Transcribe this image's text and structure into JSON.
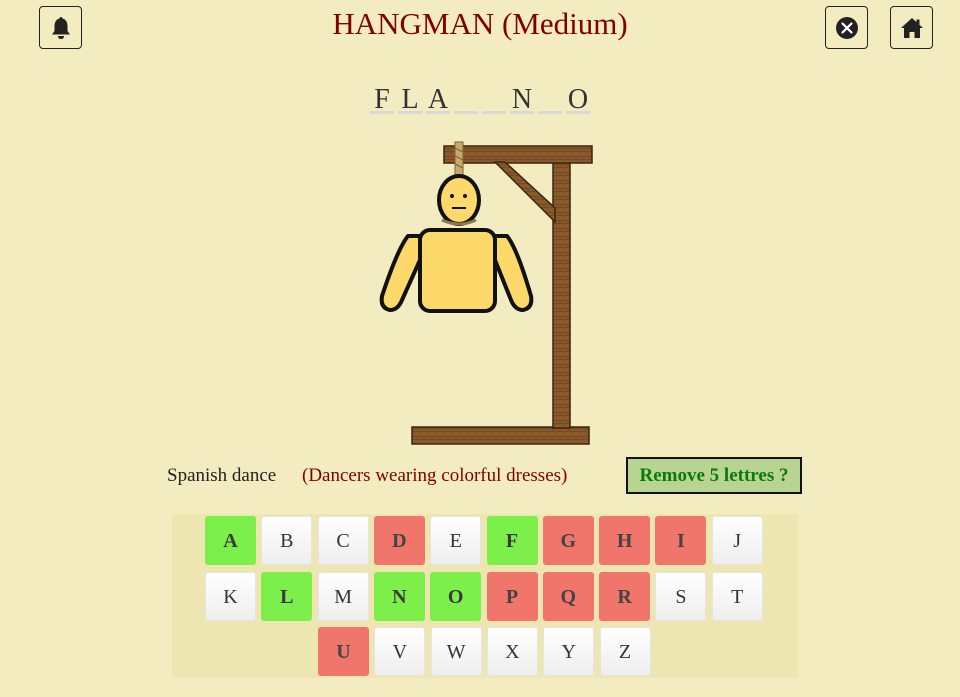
{
  "header": {
    "title": "HANGMAN (Medium)",
    "left_icon": "bell-icon",
    "right_icons": [
      "close-circle-icon",
      "home-icon"
    ]
  },
  "word": {
    "slots": [
      "F",
      "L",
      "A",
      "",
      "",
      "N",
      "",
      "O"
    ]
  },
  "hint": {
    "category": "Spanish dance",
    "clue": "(Dancers wearing colorful dresses)"
  },
  "remove_button": {
    "label": "Remove 5 lettres ?"
  },
  "keyboard": {
    "rows": [
      [
        {
          "letter": "A",
          "state": "correct"
        },
        {
          "letter": "B",
          "state": "unused"
        },
        {
          "letter": "C",
          "state": "unused"
        },
        {
          "letter": "D",
          "state": "wrong"
        },
        {
          "letter": "E",
          "state": "unused"
        },
        {
          "letter": "F",
          "state": "correct"
        },
        {
          "letter": "G",
          "state": "wrong"
        },
        {
          "letter": "H",
          "state": "wrong"
        },
        {
          "letter": "I",
          "state": "wrong"
        },
        {
          "letter": "J",
          "state": "unused"
        }
      ],
      [
        {
          "letter": "K",
          "state": "unused"
        },
        {
          "letter": "L",
          "state": "correct"
        },
        {
          "letter": "M",
          "state": "unused"
        },
        {
          "letter": "N",
          "state": "correct"
        },
        {
          "letter": "O",
          "state": "correct"
        },
        {
          "letter": "P",
          "state": "wrong"
        },
        {
          "letter": "Q",
          "state": "wrong"
        },
        {
          "letter": "R",
          "state": "wrong"
        },
        {
          "letter": "S",
          "state": "unused"
        },
        {
          "letter": "T",
          "state": "unused"
        }
      ],
      [
        {
          "letter": "U",
          "state": "wrong"
        },
        {
          "letter": "V",
          "state": "unused"
        },
        {
          "letter": "W",
          "state": "unused"
        },
        {
          "letter": "X",
          "state": "unused"
        },
        {
          "letter": "Y",
          "state": "unused"
        },
        {
          "letter": "Z",
          "state": "unused"
        }
      ]
    ]
  },
  "colors": {
    "background": "#f4ecc1",
    "title": "#800000",
    "correct": "#7cef4a",
    "wrong": "#f0766b",
    "remove_button_bg": "#b7d491",
    "remove_button_text": "#0b7a0b"
  }
}
